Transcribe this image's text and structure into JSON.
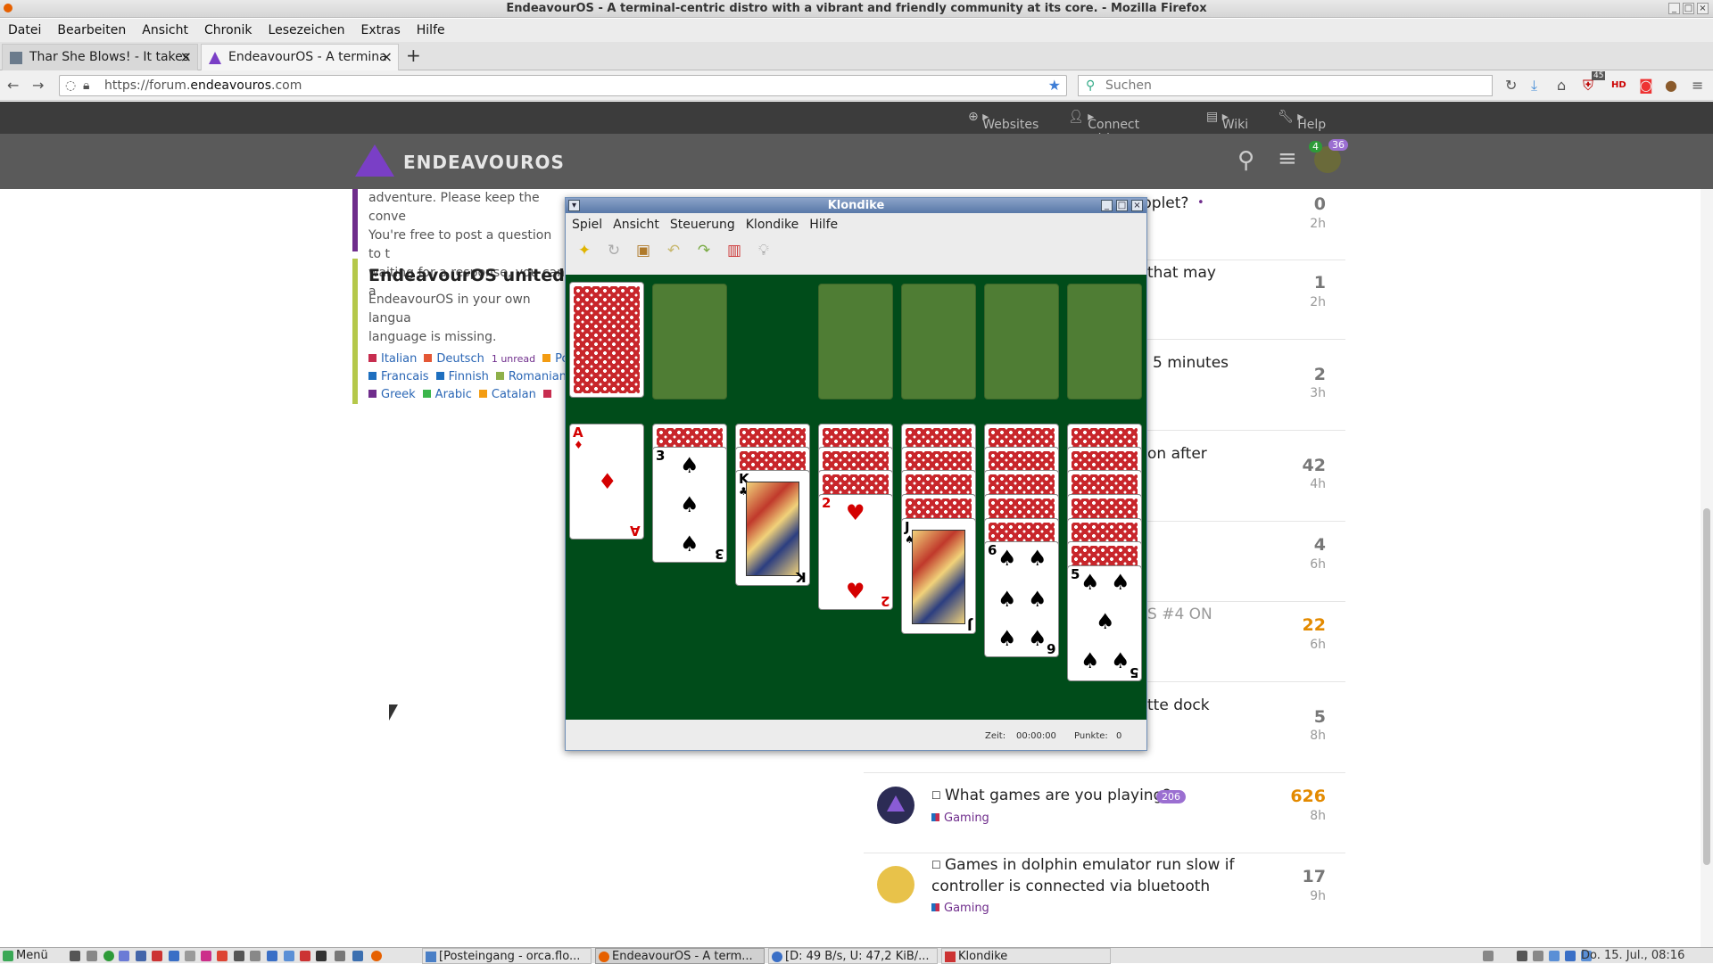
{
  "window": {
    "title": "EndeavourOS - A terminal-centric distro with a vibrant and friendly community at its core. - Mozilla Firefox"
  },
  "menubar": [
    "Datei",
    "Bearbeiten",
    "Ansicht",
    "Chronik",
    "Lesezeichen",
    "Extras",
    "Hilfe"
  ],
  "tabs": [
    {
      "label": "Thar She Blows! - It takes",
      "active": false
    },
    {
      "label": "EndeavourOS - A termina",
      "active": true
    }
  ],
  "urlbar": {
    "prefix": "https://forum.",
    "domain": "endeavouros",
    "suffix": ".com"
  },
  "searchbar": {
    "placeholder": "Suchen"
  },
  "toolbar_badges": {
    "ublock": "45"
  },
  "site": {
    "topnav": {
      "websites": "Websites",
      "connect": "Connect with us",
      "wiki": "Wiki",
      "help": "Help"
    },
    "logo": "ENDEAVOUROS",
    "notif_count": "4",
    "msg_count": "36"
  },
  "left_blocks": {
    "intro_lines": [
      "adventure. Please keep the conve",
      "You're free to post a question to t",
      "waiting for a response, you can a"
    ],
    "united": {
      "title": "EndeavourOS united",
      "desc_lines": [
        "EndeavourOS in your own langua",
        "language is missing."
      ],
      "tags_row1": [
        {
          "label": "Italian",
          "color": "#c72d4f"
        },
        {
          "label": "Deutsch",
          "color": "#e45735"
        },
        {
          "label": "1 unread",
          "color": "none"
        },
        {
          "label": "Po",
          "color": "#f39c12"
        }
      ],
      "tags_row2": [
        {
          "label": "Francais",
          "color": "#1e6fbf"
        },
        {
          "label": "Finnish",
          "color": "#1e6fbf"
        },
        {
          "label": "Romanian",
          "color": "#8eb04a"
        }
      ],
      "tags_row3": [
        {
          "label": "Greek",
          "color": "#6f2d8c"
        },
        {
          "label": "Arabic",
          "color": "#3ab54a"
        },
        {
          "label": "Catalan",
          "color": "#f39c12"
        },
        {
          "label": "",
          "color": "#c72d4f"
        }
      ]
    }
  },
  "topics": [
    {
      "title": "pplet?",
      "count": "0",
      "age": "2h"
    },
    {
      "title": "that may",
      "count": "1",
      "age": "2h"
    },
    {
      "title": "5 minutes",
      "count": "2",
      "age": "3h"
    },
    {
      "title": "on after",
      "count": "42",
      "age": "4h"
    },
    {
      "title": "",
      "count": "4",
      "age": "6h"
    },
    {
      "title": "S #4 ON",
      "count": "22",
      "age": "6h"
    },
    {
      "title": "tte dock",
      "count": "5",
      "age": "8h"
    },
    {
      "title": "What games are you playing?",
      "badge": "206",
      "category": "Gaming",
      "count": "626",
      "age": "8h"
    },
    {
      "title_lines": [
        "Games in dolphin emulator run slow if",
        "controller is connected via bluetooth"
      ],
      "category": "Gaming",
      "count": "17",
      "age": "9h"
    }
  ],
  "klondike": {
    "title": "Klondike",
    "menu": [
      "Spiel",
      "Ansicht",
      "Steuerung",
      "Klondike",
      "Hilfe"
    ],
    "tools": [
      "new-game-icon",
      "restart-icon",
      "redeal-icon",
      "undo-icon",
      "redo-icon",
      "deal-icon",
      "hint-icon"
    ],
    "status": {
      "time_label": "Zeit:",
      "time": "00:00:00",
      "score_label": "Punkte:",
      "score": "0"
    },
    "tableau": [
      {
        "hidden": 0,
        "top": {
          "rank": "A",
          "suit": "♦",
          "color": "red"
        }
      },
      {
        "hidden": 1,
        "top": {
          "rank": "3",
          "suit": "♠",
          "color": "blk"
        }
      },
      {
        "hidden": 2,
        "top": {
          "rank": "K",
          "suit": "♣",
          "color": "blk"
        }
      },
      {
        "hidden": 3,
        "top": {
          "rank": "2",
          "suit": "♥",
          "color": "red"
        }
      },
      {
        "hidden": 4,
        "top": {
          "rank": "J",
          "suit": "♠",
          "color": "blk"
        }
      },
      {
        "hidden": 5,
        "top": {
          "rank": "6",
          "suit": "♠",
          "color": "blk"
        }
      },
      {
        "hidden": 6,
        "top": {
          "rank": "5",
          "suit": "♠",
          "color": "blk"
        }
      }
    ]
  },
  "taskbar": {
    "menu": "Menü",
    "tasks": [
      "[Posteingang - orca.flo...",
      "EndeavourOS - A term...",
      "[D: 49 B/s, U: 47,2 KiB/...",
      "Klondike"
    ],
    "clock": "Do. 15. Jul., 08:16"
  }
}
